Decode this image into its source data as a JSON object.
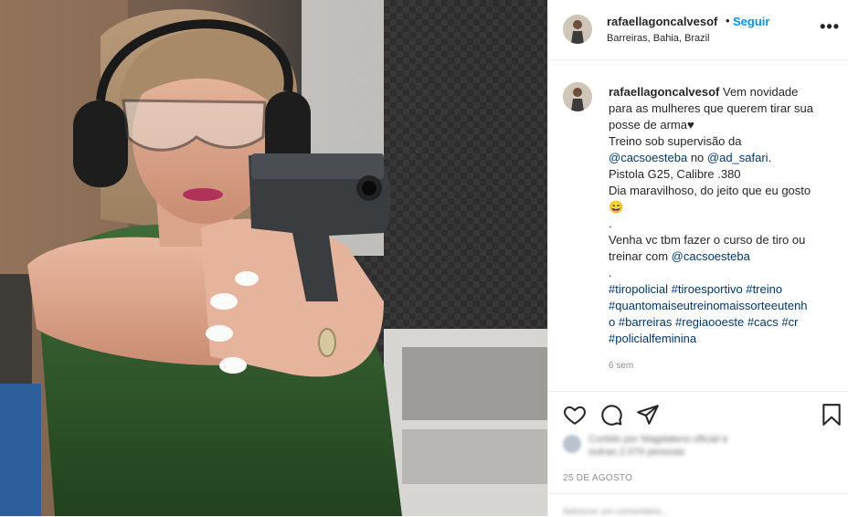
{
  "post": {
    "username": "rafaellagoncalvesof",
    "separator": "•",
    "follow_label": "Seguir",
    "location": "Barreiras, Bahia, Brazil",
    "more_label": "•••"
  },
  "caption": {
    "username": "rafaellagoncalvesof",
    "lines": [
      " Vem novidade",
      "para as mulheres que querem tirar sua",
      "posse de arma♥",
      "Treino sob supervisão da",
      "@cacsoesteba",
      " no ",
      "@ad_safari",
      ".",
      "Pistola G25, Calibre .380",
      "Dia maravilhoso, do jeito que eu gosto",
      "😄",
      ".",
      "Venha vc tbm fazer o curso de tiro ou",
      "treinar com ",
      "@cacsoesteba",
      "."
    ],
    "hashtags": [
      "#tiropolicial",
      "#tiroesportivo",
      "#treino",
      "#quantomaiseutreinomaissorteeutenh",
      "o",
      "#barreiras",
      "#regiaooeste",
      "#cacs",
      "#cr",
      "#policialfeminina"
    ],
    "age": "6 sem"
  },
  "actions": {
    "like_icon": "heart-icon",
    "comment_icon": "comment-icon",
    "share_icon": "paper-plane-icon",
    "save_icon": "bookmark-icon"
  },
  "likes_text_line1": "Curtido por Magdaleno.oficial e",
  "likes_text_line2": "outras 2.079 pessoas",
  "date": "25 DE AGOSTO",
  "comment_placeholder": "Adicione um comentário...",
  "colors": {
    "link": "#00376b",
    "follow": "#0095f6",
    "muted": "#8e8e8e",
    "border": "#efefef"
  }
}
